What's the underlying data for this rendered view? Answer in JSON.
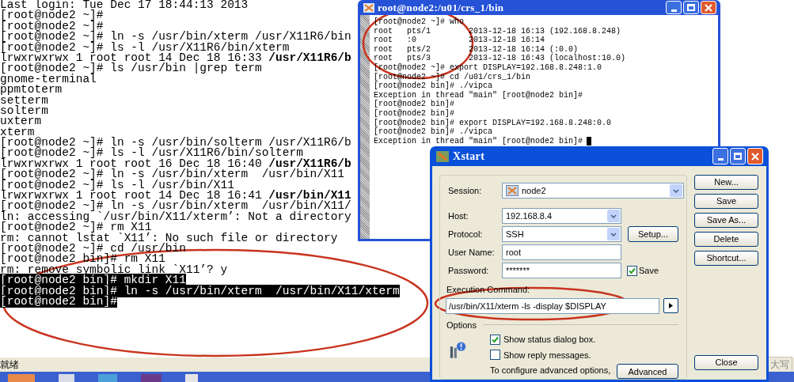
{
  "terminal": {
    "lines": [
      {
        "text": "Last login: Tue Dec 17 18:44:13 2013",
        "highlighted": false
      },
      {
        "text": "[root@node2 ~]#",
        "highlighted": false
      },
      {
        "text": "[root@node2 ~]#",
        "highlighted": false
      },
      {
        "text": "[root@node2 ~]# ln -s /usr/bin/xterm /usr/X11R6/bin",
        "highlighted": false
      },
      {
        "text": "[root@node2 ~]# ls -l /usr/X11R6/bin/xterm",
        "highlighted": false
      },
      {
        "text": "lrwxrwxrwx 1 root root 14 Dec 18 16:33 **/usr/X11R6/b**",
        "highlighted": false
      },
      {
        "text": "[root@node2 ~]# ls /usr/bin |grep term",
        "highlighted": false
      },
      {
        "text": "gnome-terminal",
        "highlighted": false
      },
      {
        "text": "ppmtoterm",
        "highlighted": false
      },
      {
        "text": "setterm",
        "highlighted": false
      },
      {
        "text": "solterm",
        "highlighted": false
      },
      {
        "text": "uxterm",
        "highlighted": false
      },
      {
        "text": "xterm",
        "highlighted": false
      },
      {
        "text": "[root@node2 ~]# ln -s /usr/bin/solterm /usr/X11R6/b",
        "highlighted": false
      },
      {
        "text": "[root@node2 ~]# ls -l /usr/X11R6/bin/solterm",
        "highlighted": false
      },
      {
        "text": "lrwxrwxrwx 1 root root 16 Dec 18 16:40 **/usr/X11R6/b**",
        "highlighted": false
      },
      {
        "text": "[root@node2 ~]# ln -s /usr/bin/xterm  /usr/bin/X11",
        "highlighted": false
      },
      {
        "text": "[root@node2 ~]# ls -l /usr/bin/X11",
        "highlighted": false
      },
      {
        "text": "lrwxrwxrwx 1 root root 14 Dec 18 16:41 **/usr/bin/X11**",
        "highlighted": false
      },
      {
        "text": "[root@node2 ~]# ln -s /usr/bin/xterm  /usr/bin/X11/",
        "highlighted": false
      },
      {
        "text": "ln: accessing `/usr/bin/X11/xterm’: Not a directory",
        "highlighted": false
      },
      {
        "text": "[root@node2 ~]# rm X11",
        "highlighted": false
      },
      {
        "text": "rm: cannot lstat `X11’: No such file or directory",
        "highlighted": false
      },
      {
        "text": "[root@node2 ~]# cd /usr/bin",
        "highlighted": false
      },
      {
        "text": "[root@node2 bin]# rm X11",
        "highlighted": false
      },
      {
        "text": "rm: remove symbolic link `X11’? y",
        "highlighted": false
      },
      {
        "text": "[root@node2 bin]# mkdir X11",
        "highlighted": true
      },
      {
        "text": "[root@node2 bin]# ln -s /usr/bin/xterm  /usr/bin/X11/xterm",
        "highlighted": true
      },
      {
        "text": "[root@node2 bin]#",
        "highlighted": true
      }
    ]
  },
  "status_bar": {
    "left": "就绪",
    "right": "大写"
  },
  "xterm_window": {
    "title": "root@node2:/u01/crs_1/bin",
    "lines": [
      "[root@node2 ~]# who",
      "root   pts/1        2013-12-18 16:13 (192.168.8.248)",
      "root   :0           2013-12-18 16:14",
      "root   pts/2        2013-12-18 16:14 (:0.0)",
      "root   pts/3        2013-12-18 16:43 (localhost:10.0)",
      "[root@node2 ~]# export DISPLAY=192.168.8.248:1.0",
      "[root@node2 ~]# cd /u01/crs_1/bin",
      "[root@node2 bin]# ./vipca",
      "Exception in thread \"main\" [root@node2 bin]#",
      "[root@node2 bin]#",
      "[root@node2 bin]#",
      "[root@node2 bin]# export DISPLAY=192.168.8.248:0.0",
      "[root@node2 bin]# ./vipca",
      "Exception in thread \"main\" [root@node2 bin]#"
    ]
  },
  "xstart_dialog": {
    "title": "Xstart",
    "session": {
      "label": "Session:",
      "value": "node2"
    },
    "host": {
      "label": "Host:",
      "value": "192.168.8.4"
    },
    "protocol": {
      "label": "Protocol:",
      "value": "SSH",
      "button": "Setup..."
    },
    "user_name": {
      "label": "User Name:",
      "value": "root"
    },
    "password": {
      "label": "Password:",
      "value": "*******",
      "save": {
        "label": "Save",
        "checked": true
      }
    },
    "execution_command": {
      "label": "Execution Command:",
      "value": "/usr/bin/X11/xterm -ls -display $DISPLAY"
    },
    "options": {
      "title": "Options",
      "checkboxes": [
        {
          "label": "Show status dialog box.",
          "checked": true
        },
        {
          "label": "Show reply messages.",
          "checked": false
        }
      ],
      "note": "To configure advanced options,",
      "advanced_button": "Advanced"
    },
    "buttons": [
      "New...",
      "Save",
      "Save As...",
      "Delete",
      "Shortcut..."
    ],
    "close_button": "Close"
  }
}
